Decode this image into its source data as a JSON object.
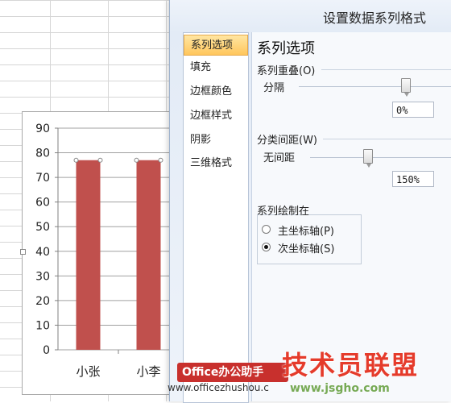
{
  "dialog": {
    "title": "设置数据系列格式",
    "nav": [
      {
        "label": "系列选项",
        "active": true
      },
      {
        "label": "填充",
        "active": false
      },
      {
        "label": "边框颜色",
        "active": false
      },
      {
        "label": "边框样式",
        "active": false
      },
      {
        "label": "阴影",
        "active": false
      },
      {
        "label": "三维格式",
        "active": false
      }
    ],
    "panel_title": "系列选项",
    "overlap": {
      "label": "系列重叠(O)",
      "left_label": "分隔",
      "value": "0%"
    },
    "gap": {
      "label": "分类间距(W)",
      "left_label": "无间距",
      "value": "150%"
    },
    "plot_on": {
      "label": "系列绘制在",
      "options": [
        {
          "label": "主坐标轴(P)",
          "checked": false
        },
        {
          "label": "次坐标轴(S)",
          "checked": true
        }
      ]
    }
  },
  "chart_data": {
    "type": "bar",
    "categories": [
      "小张",
      "小李"
    ],
    "values": [
      77,
      77
    ],
    "ylim": [
      0,
      90
    ],
    "yticks": [
      "0",
      "10",
      "20",
      "30",
      "40",
      "50",
      "60",
      "70",
      "80",
      "90"
    ],
    "bar_color": "#c0504d",
    "grid": true
  },
  "watermarks": {
    "badge": "Office办公助手",
    "brand": "技术员联盟",
    "url_left": "www.officezhushou.c",
    "url_right": "www.jsgho.com"
  }
}
